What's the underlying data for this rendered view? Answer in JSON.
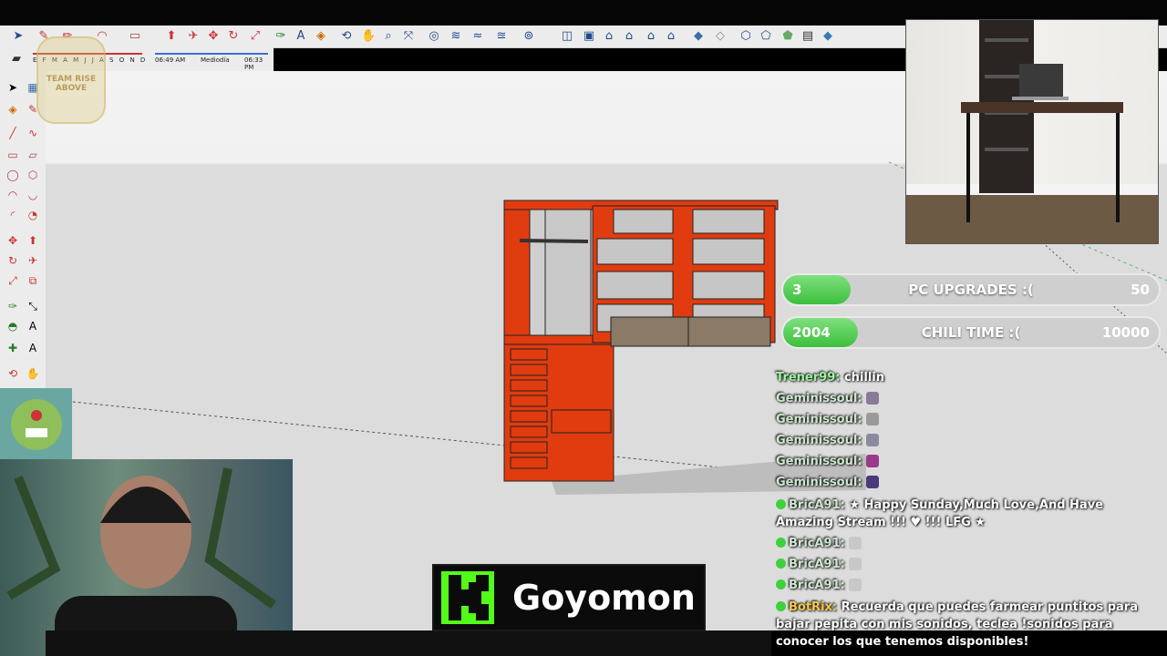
{
  "shadow_settings": {
    "months": [
      "E",
      "F",
      "M",
      "A",
      "M",
      "J",
      "J",
      "A",
      "S",
      "O",
      "N",
      "D"
    ],
    "time_start": "06:49 AM",
    "time_mid": "Mediodía",
    "time_end": "06:33 PM"
  },
  "goals": [
    {
      "count": "3",
      "label": "PC UPGRADES :(",
      "goal": "50",
      "progress": 0.06
    },
    {
      "count": "2004",
      "label": "CHILI TIME :(",
      "goal": "10000",
      "progress": 0.2
    }
  ],
  "chat": [
    {
      "user": "Trener99:",
      "text": "chillin",
      "badge": false,
      "emote": ""
    },
    {
      "user": "Geminissoul:",
      "text": "",
      "badge": false,
      "emote": "#8a7a9a"
    },
    {
      "user": "Geminissoul:",
      "text": "",
      "badge": false,
      "emote": "#9a9a9a"
    },
    {
      "user": "Geminissoul:",
      "text": "",
      "badge": false,
      "emote": "#8a8aa0"
    },
    {
      "user": "Geminissoul:",
      "text": "",
      "badge": false,
      "emote": "#9a3a8a"
    },
    {
      "user": "Geminissoul:",
      "text": "",
      "badge": false,
      "emote": "#4a3a7a"
    },
    {
      "user": "BricA91:",
      "text": "★ Happy Sunday,Much Love,And Have Amazing Stream !!! ♥ !!! LFG ★",
      "badge": true,
      "emote": ""
    },
    {
      "user": "BricA91:",
      "text": "",
      "badge": true,
      "emote": "#c8c8c8"
    },
    {
      "user": "BricA91:",
      "text": "",
      "badge": true,
      "emote": "#c8c8c8"
    },
    {
      "user": "BricA91:",
      "text": "",
      "badge": true,
      "emote": "#c8c8c8"
    },
    {
      "user": "BotRix:",
      "text": "Recuerda que puedes farmear puntitos para bajar pepita con mis sonidos, teclea !sonidos para conocer los que tenemos disponibles!",
      "badge": true,
      "emote": ""
    }
  ],
  "streamer": {
    "name": "Goyomon"
  },
  "watermark": "TEAM RISE ABOVE",
  "colors": {
    "cabinet": "#e03c10",
    "kick_green": "#53fc18",
    "goal_fill": "#4ccb4c"
  }
}
